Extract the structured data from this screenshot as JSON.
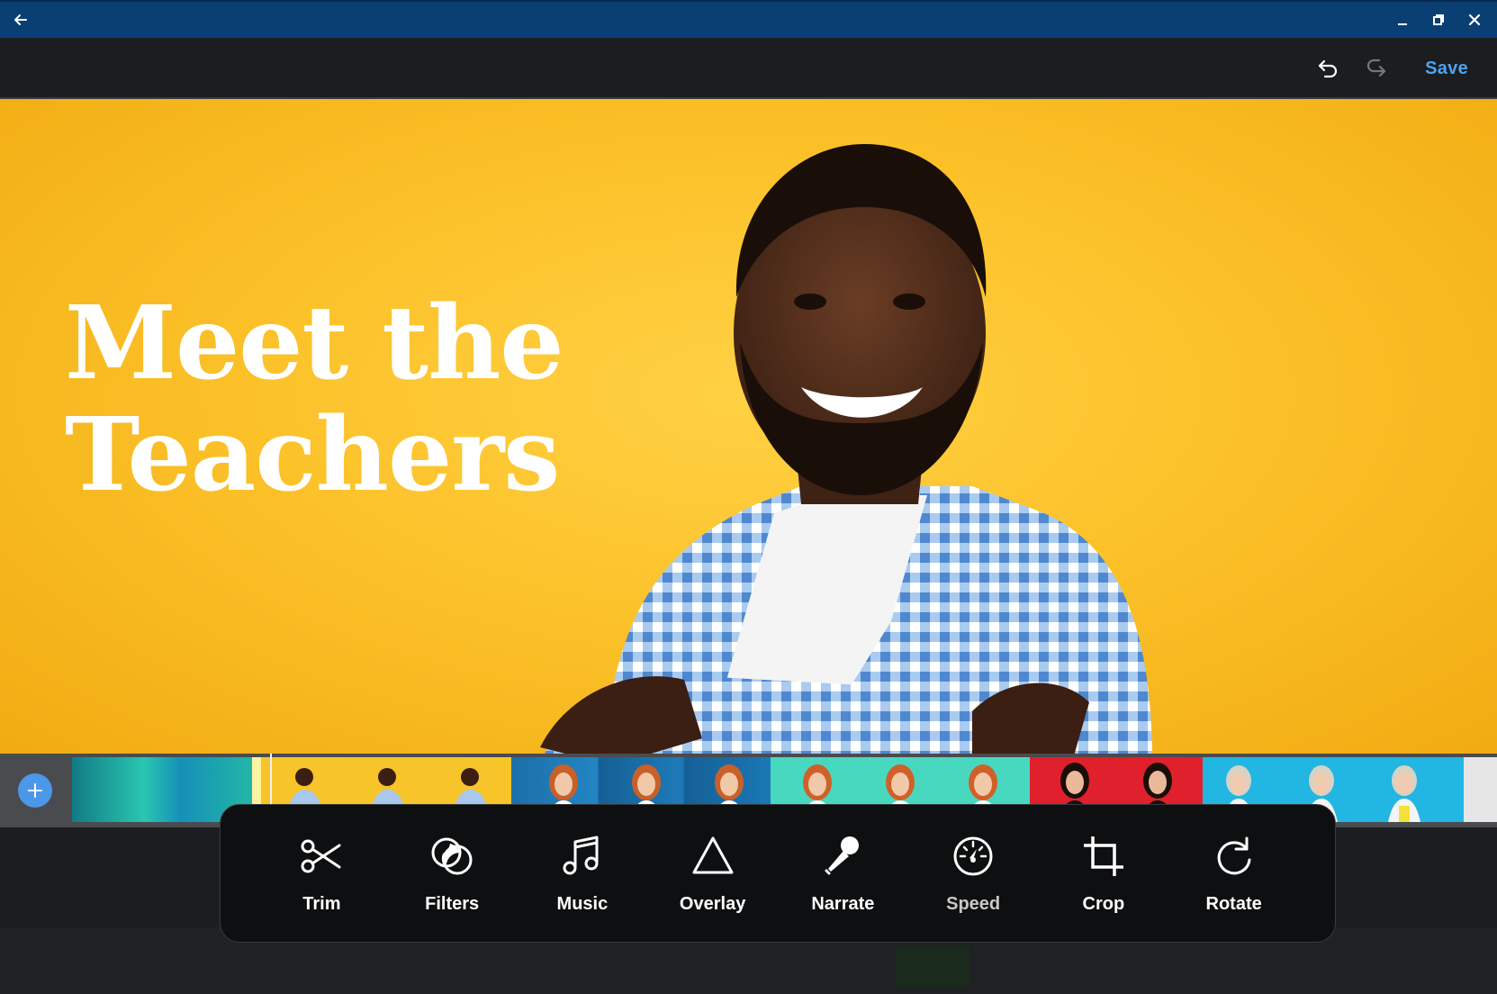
{
  "window": {
    "back_icon": "arrow-left-icon",
    "minimize_icon": "minimize-icon",
    "restore_icon": "restore-icon",
    "close_icon": "close-icon"
  },
  "toolbar": {
    "undo_icon": "undo-icon",
    "redo_icon": "redo-icon",
    "save_label": "Save",
    "accent_color": "#4da3f0"
  },
  "preview": {
    "headline_line1": "Meet the",
    "headline_line2": "Teachers",
    "background_color": "#fcc22a"
  },
  "timeline": {
    "add_icon": "plus-icon",
    "clips": [
      {
        "name": "teal-gradient",
        "color": "#1aa6a0"
      },
      {
        "name": "man-yellow",
        "color": "#f7c42a"
      },
      {
        "name": "woman-blue",
        "color": "#1a78b5"
      },
      {
        "name": "woman-mint",
        "color": "#48d8c0"
      },
      {
        "name": "woman-red",
        "color": "#e0202c"
      },
      {
        "name": "woman-cyan",
        "color": "#22b6e2"
      }
    ]
  },
  "tools": [
    {
      "id": "trim",
      "label": "Trim",
      "icon": "scissors-icon"
    },
    {
      "id": "filters",
      "label": "Filters",
      "icon": "filters-icon"
    },
    {
      "id": "music",
      "label": "Music",
      "icon": "music-note-icon"
    },
    {
      "id": "overlay",
      "label": "Overlay",
      "icon": "triangle-icon"
    },
    {
      "id": "narrate",
      "label": "Narrate",
      "icon": "microphone-icon"
    },
    {
      "id": "speed",
      "label": "Speed",
      "icon": "speedometer-icon"
    },
    {
      "id": "crop",
      "label": "Crop",
      "icon": "crop-icon"
    },
    {
      "id": "rotate",
      "label": "Rotate",
      "icon": "rotate-icon"
    }
  ]
}
